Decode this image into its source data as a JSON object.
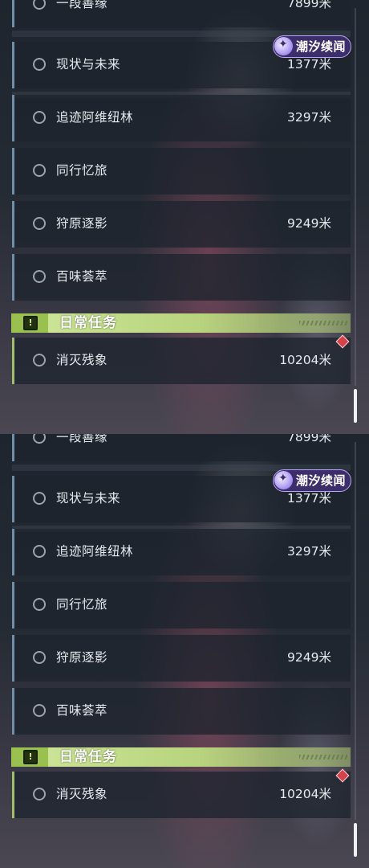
{
  "quests": [
    {
      "name": "一段善缘",
      "distance": "7899米"
    },
    {
      "name": "现状与未来",
      "distance": "1377米"
    },
    {
      "name": "追迹阿维纽林",
      "distance": "3297米"
    },
    {
      "name": "同行忆旅",
      "distance": ""
    },
    {
      "name": "狩原逐影",
      "distance": "9249米"
    },
    {
      "name": "百味荟萃",
      "distance": ""
    }
  ],
  "daily": {
    "title": "日常任务",
    "icon_glyph": "!",
    "quest": {
      "name": "消灭残象",
      "distance": "10204米"
    }
  },
  "badge": {
    "text": "潮汐续闻",
    "icon": "sparkle-icon"
  },
  "colors": {
    "quest_accent": "#6f8fa9",
    "daily_accent": "#a3bd6b",
    "daily_header": "#cfe79a",
    "badge_bg": "#3b2e6b",
    "marker": "#d6424a"
  }
}
